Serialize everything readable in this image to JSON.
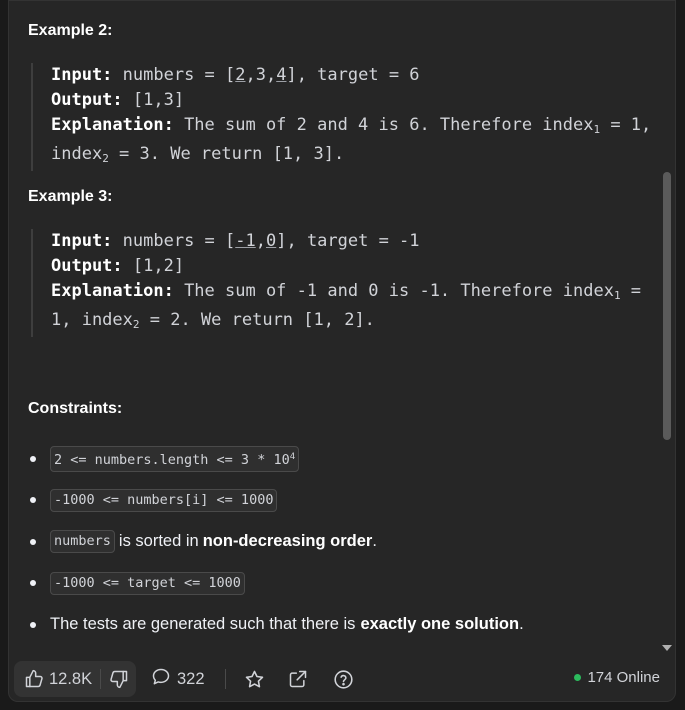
{
  "example2": {
    "title": "Example 2:",
    "input_label": "Input:",
    "input_pre": " numbers = [",
    "input_u1": "2",
    "input_mid1": ",3,",
    "input_u2": "4",
    "input_post": "], target = 6",
    "output_label": "Output:",
    "output_value": " [1,3]",
    "explanation_label": "Explanation:",
    "explanation_a": " The sum of 2 and 4 is 6. Therefore index",
    "sub1": "1",
    "explanation_b": " = 1, index",
    "sub2": "2",
    "explanation_c": " = 3. We return [1, 3]."
  },
  "example3": {
    "title": "Example 3:",
    "input_label": "Input:",
    "input_pre": " numbers = [",
    "input_u1": "-1",
    "input_mid1": ",",
    "input_u2": "0",
    "input_post": "], target = -1",
    "output_label": "Output:",
    "output_value": " [1,2]",
    "explanation_label": "Explanation:",
    "explanation_a": " The sum of -1 and 0 is -1. Therefore index",
    "sub1": "1",
    "explanation_b": " = 1, index",
    "sub2": "2",
    "explanation_c": " = 2. We return [1, 2]."
  },
  "constraints": {
    "title": "Constraints:",
    "c1_code": "2 <= numbers.length <= 3 * 10",
    "c1_sup": "4",
    "c2_code": "-1000 <= numbers[i] <= 1000",
    "c3_code": "numbers",
    "c3_text": "is sorted in",
    "c3_bold": "non-decreasing order",
    "c3_end": ".",
    "c4_code": "-1000 <= target <= 1000",
    "c5_text": "The tests are generated such that there is",
    "c5_bold": "exactly one solution",
    "c5_end": "."
  },
  "toolbar": {
    "like_count": "12.8K",
    "comment_count": "322",
    "online_text": "174 Online",
    "online_color": "#2cbb5d"
  },
  "icons": {
    "like": "thumbs-up-icon",
    "dislike": "thumbs-down-icon",
    "comment": "comment-icon",
    "favorite": "star-icon",
    "share": "external-link-icon",
    "help": "question-circle-icon"
  }
}
